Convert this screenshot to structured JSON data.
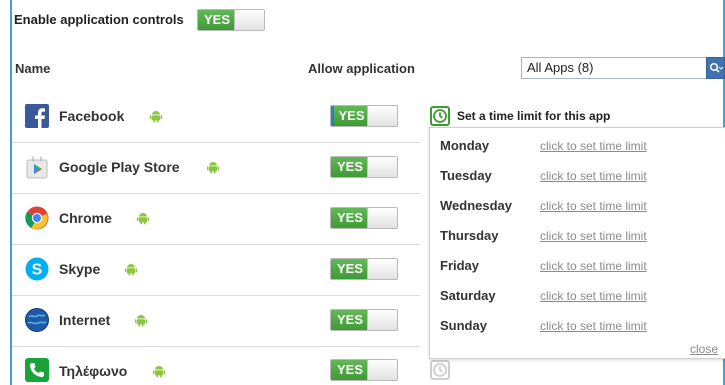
{
  "header": {
    "enable_label": "Enable application controls",
    "enable_toggle": "YES",
    "col_name": "Name",
    "col_allow": "Allow application",
    "filter_value": "All Apps (8)"
  },
  "apps": [
    {
      "name": "Facebook",
      "toggle": "YES",
      "icon": "facebook-icon"
    },
    {
      "name": "Google Play Store",
      "toggle": "YES",
      "icon": "google-play-store-icon"
    },
    {
      "name": "Chrome",
      "toggle": "YES",
      "icon": "chrome-icon"
    },
    {
      "name": "Skype",
      "toggle": "YES",
      "icon": "skype-icon"
    },
    {
      "name": "Internet",
      "toggle": "YES",
      "icon": "internet-globe-icon"
    },
    {
      "name": "Τηλέφωνο",
      "toggle": "YES",
      "icon": "phone-icon"
    }
  ],
  "time_limit": {
    "title": "Set a time limit for this app",
    "days": [
      {
        "day": "Monday",
        "link": "click to set time limit"
      },
      {
        "day": "Tuesday",
        "link": "click to set time limit"
      },
      {
        "day": "Wednesday",
        "link": "click to set time limit"
      },
      {
        "day": "Thursday",
        "link": "click to set time limit"
      },
      {
        "day": "Friday",
        "link": "click to set time limit"
      },
      {
        "day": "Saturday",
        "link": "click to set time limit"
      },
      {
        "day": "Sunday",
        "link": "click to set time limit"
      }
    ],
    "close": "close"
  },
  "colors": {
    "toggle_on": "#4caf44",
    "frame_border": "#3ea0dd",
    "search_button": "#3f73b0",
    "clock_green": "#3e9a34",
    "android_green": "#8cc63e"
  }
}
